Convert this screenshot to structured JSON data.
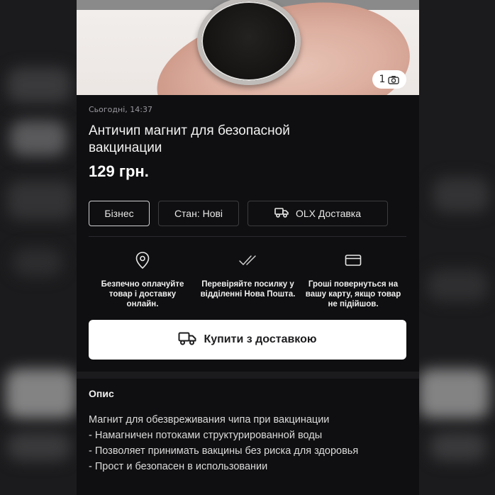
{
  "photo": {
    "counter": "1"
  },
  "listing": {
    "date": "Сьогодні, 14:37",
    "title": "Античип магнит для безопасной вакцинации",
    "price": "129 грн."
  },
  "chips": {
    "business": "Бізнес",
    "state": "Стан: Нові",
    "delivery": "OLX Доставка"
  },
  "features": [
    {
      "icon": "location-pin-icon",
      "text": "Безпечно оплачуйте товар і доставку онлайн."
    },
    {
      "icon": "double-check-icon",
      "text": "Перевіряйте посилку у відділенні Нова Пошта."
    },
    {
      "icon": "card-icon",
      "text": "Гроші повернуться на вашу карту, якщо товар не підійшов."
    }
  ],
  "buy_button": {
    "label": "Купити з доставкою"
  },
  "description": {
    "heading": "Опис",
    "lines": [
      "Магнит для обезвреживания чипа при вакцинации",
      "- Намагничен потоками структурированной воды",
      "- Позволяет принимать вакцины без риска для здоровья",
      "- Прост и безопасен в использовании"
    ]
  },
  "colors": {
    "screen_bg": "#0f0f11",
    "button_bg": "#ffffff",
    "text_primary": "#ffffff",
    "text_muted": "#9a9aa0"
  }
}
